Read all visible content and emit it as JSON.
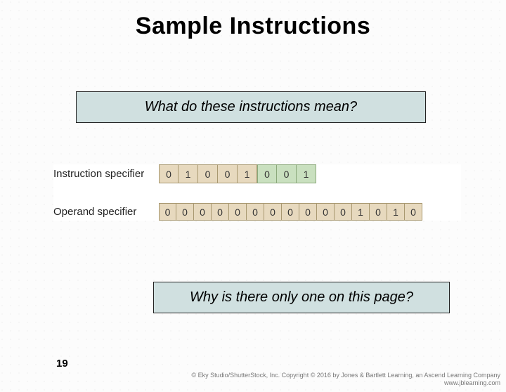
{
  "title": "Sample Instructions",
  "question1": "What do these instructions mean?",
  "question2": "Why is there only one on this page?",
  "figure": {
    "row1": {
      "label": "Instruction specifier",
      "bits": [
        "0",
        "1",
        "0",
        "0",
        "1",
        "0",
        "0",
        "1"
      ]
    },
    "row2": {
      "label": "Operand specifier",
      "bits": [
        "0",
        "0",
        "0",
        "0",
        "0",
        "0",
        "0",
        "0",
        "0",
        "0",
        "0",
        "1",
        "0",
        "1",
        "0"
      ]
    }
  },
  "page_number": "19",
  "copyright_line1": "© Eky Studio/ShutterStock, Inc. Copyright © 2016 by Jones & Bartlett Learning, an Ascend Learning Company",
  "copyright_line2": "www.jblearning.com"
}
